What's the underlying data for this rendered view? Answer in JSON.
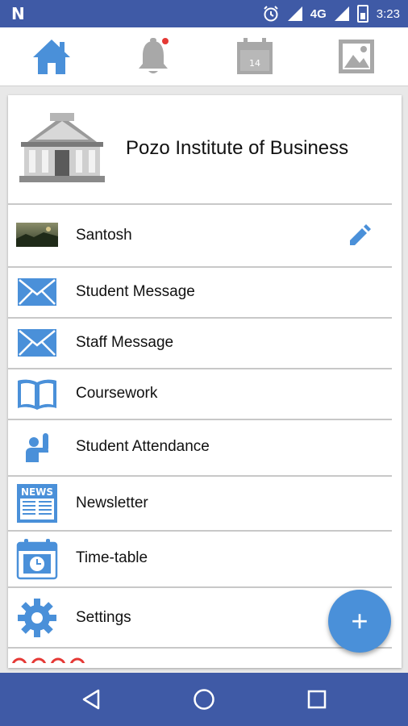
{
  "status_bar": {
    "logo": "N",
    "network": "4G",
    "time": "3:23"
  },
  "top_tabs": [
    {
      "name": "home",
      "icon": "home-icon"
    },
    {
      "name": "notifications",
      "icon": "bell-icon"
    },
    {
      "name": "calendar",
      "icon": "calendar-icon",
      "day": "14"
    },
    {
      "name": "gallery",
      "icon": "image-icon"
    }
  ],
  "colors": {
    "accent": "#4a90d9",
    "status_bar": "#3f5aa6",
    "inactive_icon": "#a8a8a8",
    "badge": "#e53935"
  },
  "institute": {
    "name": "Pozo Institute of Business"
  },
  "profile": {
    "name": "Santosh"
  },
  "menu": [
    {
      "label": "Student Message",
      "icon": "envelope-icon"
    },
    {
      "label": "Staff Message",
      "icon": "envelope-icon"
    },
    {
      "label": "Coursework",
      "icon": "book-icon"
    },
    {
      "label": "Student Attendance",
      "icon": "raised-hand-icon"
    },
    {
      "label": "Newsletter",
      "icon": "newspaper-icon"
    },
    {
      "label": "Time-table",
      "icon": "calendar-clock-icon"
    },
    {
      "label": "Settings",
      "icon": "gear-icon"
    }
  ],
  "news_icon_text": "NEWS",
  "fab": {
    "label": "+"
  }
}
